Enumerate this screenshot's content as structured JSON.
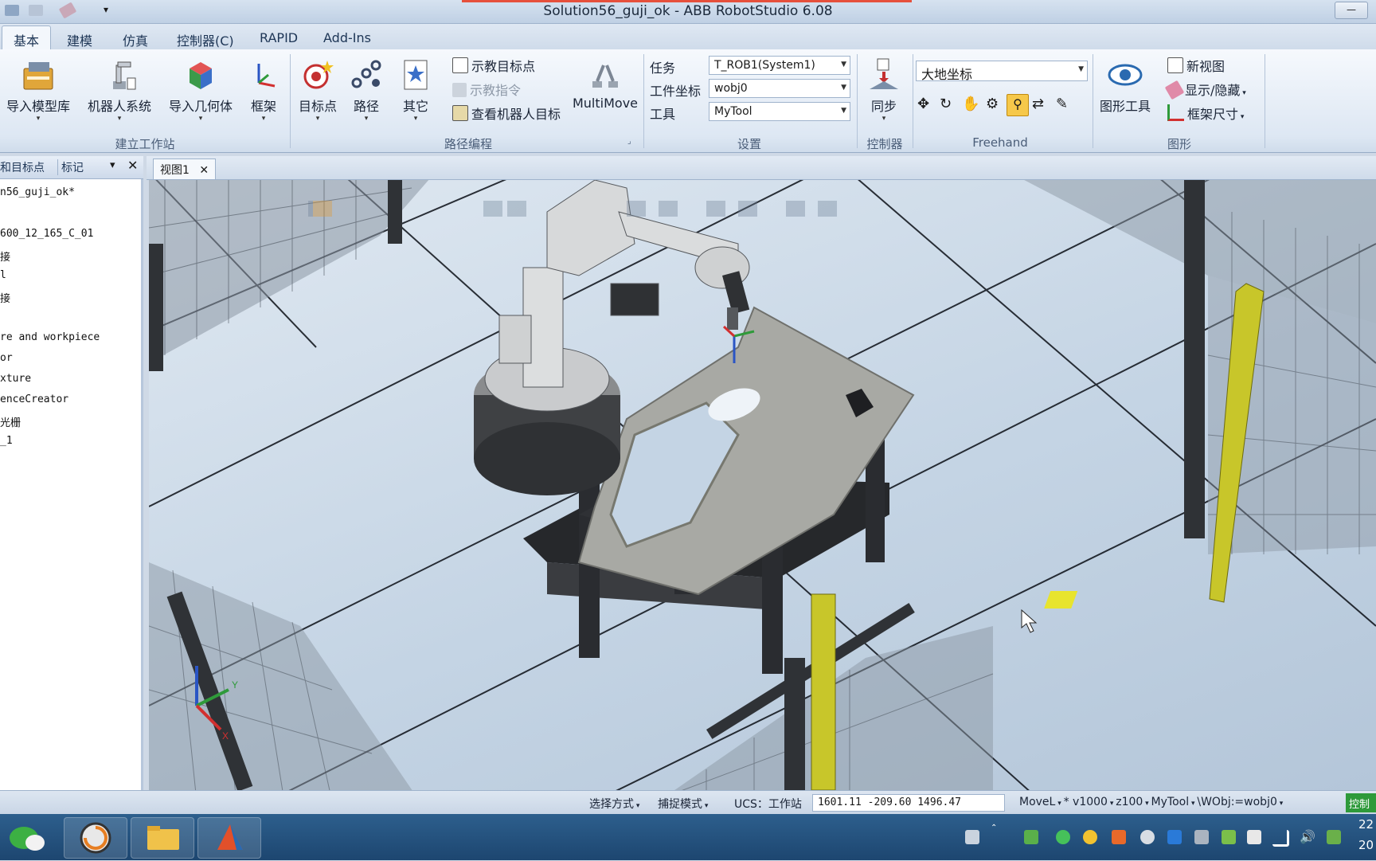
{
  "window": {
    "title": "Solution56_guji_ok - ABB RobotStudio 6.08"
  },
  "ribbon_tabs": [
    "基本",
    "建模",
    "仿真",
    "控制器(C)",
    "RAPID",
    "Add-Ins"
  ],
  "ribbon": {
    "build_station": {
      "label": "建立工作站",
      "import_library": "导入模型库",
      "robot_system": "机器人系统",
      "import_geometry": "导入几何体",
      "frame": "框架"
    },
    "path_programming": {
      "label": "路径编程",
      "target": "目标点",
      "path": "路径",
      "other": "其它",
      "teach_target": "示教目标点",
      "teach_instruction": "示教指令",
      "view_robot_target": "查看机器人目标",
      "multimove": "MultiMove"
    },
    "settings": {
      "label": "设置",
      "task_label": "任务",
      "task_value": "T_ROB1(System1)",
      "workobject_label": "工件坐标",
      "workobject_value": "wobj0",
      "tool_label": "工具",
      "tool_value": "MyTool"
    },
    "controller": {
      "label": "控制器",
      "sync": "同步"
    },
    "freehand": {
      "label": "Freehand",
      "reference_value": "大地坐标"
    },
    "graphics": {
      "label": "图形",
      "graphics_tools": "图形工具",
      "new_view": "新视图",
      "show_hide": "显示/隐藏",
      "frame_size": "框架尺寸"
    }
  },
  "left_panel": {
    "tabs": [
      "和目标点",
      "标记"
    ],
    "items": [
      "n56_guji_ok*",
      "",
      "600_12_165_C_01",
      "接",
      "l",
      "接",
      "",
      "re and workpiece",
      "or",
      "xture",
      "enceCreator",
      "光栅",
      "_1"
    ]
  },
  "viewport": {
    "tab": "视图1",
    "axis_labels": {
      "x": "X",
      "y": "Y"
    }
  },
  "status_bar": {
    "select_mode": "选择方式",
    "snap_mode": "捕捉模式",
    "ucs": "UCS：工作站",
    "coords": "1601.11   -209.60   1496.47",
    "instruction": "MoveL",
    "star": "*",
    "speed": "v1000",
    "zone": "z100",
    "tool": "MyTool",
    "wobj": "\\WObj:=wobj0",
    "controller_button": "控制"
  },
  "taskbar": {
    "clock_top": "22",
    "clock_bottom": "20"
  },
  "colors": {
    "ribbon_bg": "#dde7f3",
    "viewport_bg": "#c4d4e4",
    "fence": "#2f3236",
    "light_curtain": "#c8c62a",
    "controller_green": "#2e9a3a",
    "taskbar": "#2d5f8d"
  }
}
